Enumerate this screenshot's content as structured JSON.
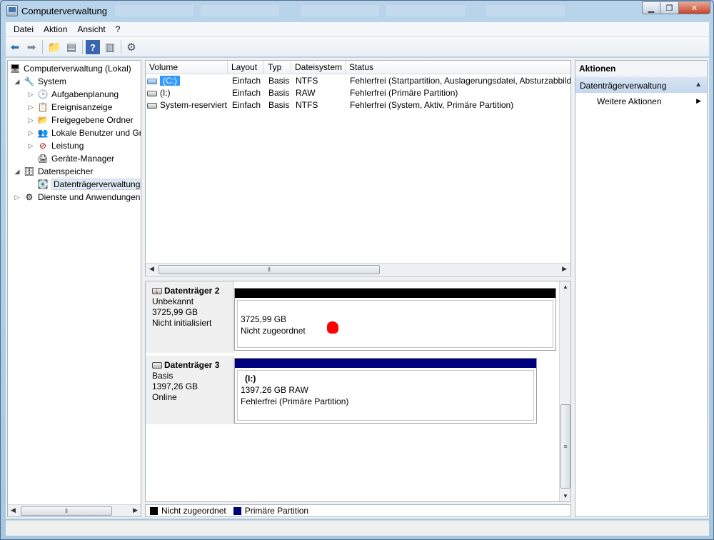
{
  "window": {
    "title": "Computerverwaltung"
  },
  "menu": [
    "Datei",
    "Aktion",
    "Ansicht",
    "?"
  ],
  "tree": {
    "root": "Computerverwaltung (Lokal)",
    "system": "System",
    "aufgabenplanung": "Aufgabenplanung",
    "ereignisanzeige": "Ereignisanzeige",
    "freigegebene_ordner": "Freigegebene Ordner",
    "lokale_benutzer": "Lokale Benutzer und Gr",
    "leistung": "Leistung",
    "geraete_manager": "Geräte-Manager",
    "datenspeicher": "Datenspeicher",
    "datentraegerverwaltung": "Datenträgerverwaltung",
    "dienste": "Dienste und Anwendungen"
  },
  "volumes": {
    "columns": [
      "Volume",
      "Layout",
      "Typ",
      "Dateisystem",
      "Status"
    ],
    "rows": [
      {
        "volume": "(C:)",
        "layout": "Einfach",
        "typ": "Basis",
        "dateisystem": "NTFS",
        "status": "Fehlerfrei (Startpartition, Auslagerungsdatei, Absturzabbild"
      },
      {
        "volume": "(I:)",
        "layout": "Einfach",
        "typ": "Basis",
        "dateisystem": "RAW",
        "status": "Fehlerfrei (Primäre Partition)"
      },
      {
        "volume": "System-reserviert",
        "layout": "Einfach",
        "typ": "Basis",
        "dateisystem": "NTFS",
        "status": "Fehlerfrei (System, Aktiv, Primäre Partition)"
      }
    ]
  },
  "disks": [
    {
      "name": "Datenträger 2",
      "type": "Unbekannt",
      "size": "3725,99 GB",
      "state": "Nicht initialisiert",
      "partition": {
        "label": "",
        "size": "3725,99 GB",
        "info": "Nicht zugeordnet"
      },
      "bar_color": "#000000"
    },
    {
      "name": "Datenträger 3",
      "type": "Basis",
      "size": "1397,26 GB",
      "state": "Online",
      "partition": {
        "label": "(I:)",
        "size": "1397,26 GB RAW",
        "info": "Fehlerfrei (Primäre Partition)"
      },
      "bar_color": "#00007f"
    }
  ],
  "legend": [
    {
      "label": "Nicht zugeordnet",
      "color": "#000000"
    },
    {
      "label": "Primäre Partition",
      "color": "#00007f"
    }
  ],
  "actions": {
    "title": "Aktionen",
    "group": "Datenträgerverwaltung",
    "item": "Weitere Aktionen"
  }
}
